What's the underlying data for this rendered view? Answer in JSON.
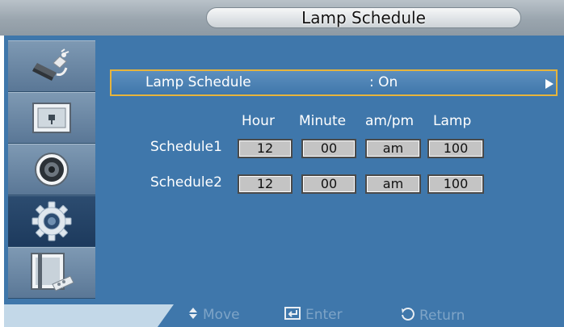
{
  "title": "Lamp Schedule",
  "sidebar": {
    "items": [
      {
        "icon": "input-plug-icon"
      },
      {
        "icon": "picture-icon"
      },
      {
        "icon": "sound-icon"
      },
      {
        "icon": "setup-gear-icon",
        "active": true
      },
      {
        "icon": "multi-control-icon"
      }
    ]
  },
  "menu": {
    "label": "Lamp Schedule",
    "value": ": On"
  },
  "headers": {
    "hour": "Hour",
    "minute": "Minute",
    "ampm": "am/pm",
    "lamp": "Lamp"
  },
  "schedules": [
    {
      "label": "Schedule1",
      "hour": "12",
      "minute": "00",
      "ampm": "am",
      "lamp": "100"
    },
    {
      "label": "Schedule2",
      "hour": "12",
      "minute": "00",
      "ampm": "am",
      "lamp": "100"
    }
  ],
  "footer": {
    "move": "Move",
    "enter": "Enter",
    "return": "Return"
  },
  "colors": {
    "panel": "#3f77ab",
    "highlight_border": "#e6b43c",
    "footer_text": "#7ea4c7"
  }
}
